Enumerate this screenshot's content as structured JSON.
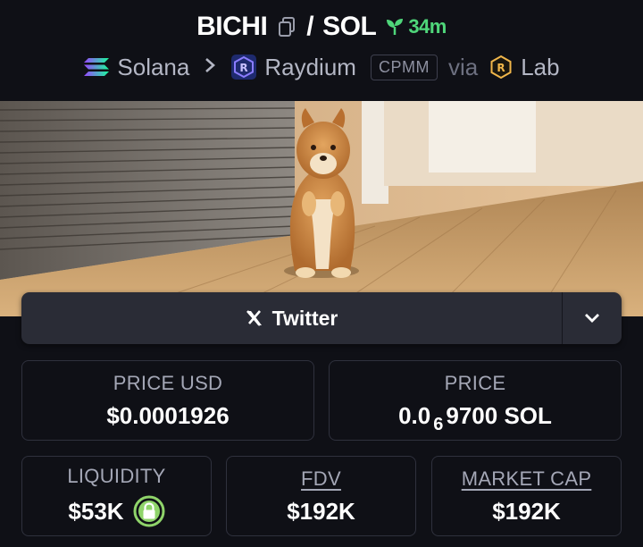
{
  "header": {
    "base_token": "BICHI",
    "separator": "/",
    "quote_token": "SOL",
    "age": "34m",
    "chain": "Solana",
    "dex": "Raydium",
    "pool_type": "CPMM",
    "via": "via",
    "launchpad": "Lab"
  },
  "social": {
    "twitter_label": "Twitter"
  },
  "stats": {
    "price_usd": {
      "label": "PRICE USD",
      "value": "$0.0001926"
    },
    "price": {
      "label": "PRICE",
      "prefix": "0.0",
      "zeros": "6",
      "suffix": "9700 SOL"
    },
    "liquidity": {
      "label": "LIQUIDITY",
      "value": "$53K"
    },
    "fdv": {
      "label": "FDV",
      "value": "$192K"
    },
    "market_cap": {
      "label": "MARKET CAP",
      "value": "$192K"
    }
  },
  "colors": {
    "accent_green": "#4fd67a",
    "lock_green": "#8fd46a",
    "background": "#0f1016"
  }
}
